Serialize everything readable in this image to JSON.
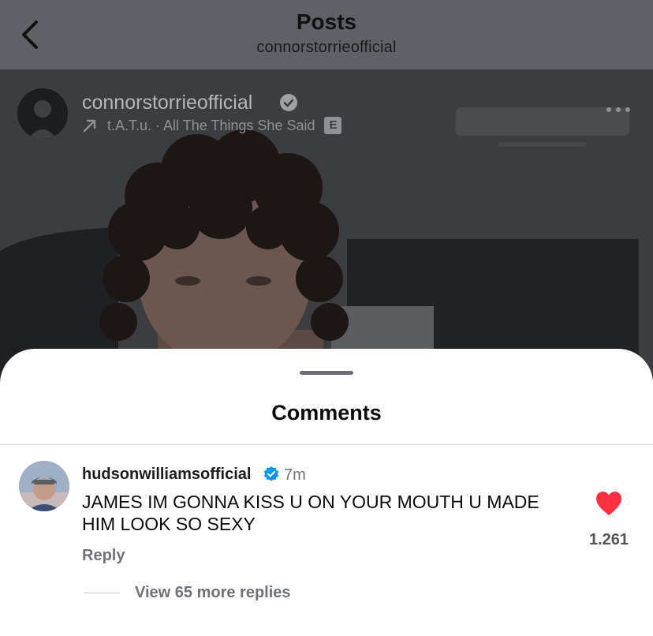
{
  "header": {
    "title": "Posts",
    "subtitle": "connorstorrieofficial"
  },
  "post": {
    "username": "connorstorrieofficial",
    "music": "t.A.T.u. · All The Things She Said",
    "explicit_label": "E"
  },
  "comments_sheet": {
    "title": "Comments",
    "comment": {
      "username": "hudsonwilliamsofficial",
      "time": "7m",
      "text": "JAMES IM GONNA KISS U ON YOUR MOUTH U MADE HIM LOOK SO SEXY",
      "like_count": "1.261",
      "reply_label": "Reply",
      "view_replies_label": "View 65 more replies"
    }
  },
  "colors": {
    "like_red": "#ff3040",
    "verified_blue": "#0095f6"
  }
}
